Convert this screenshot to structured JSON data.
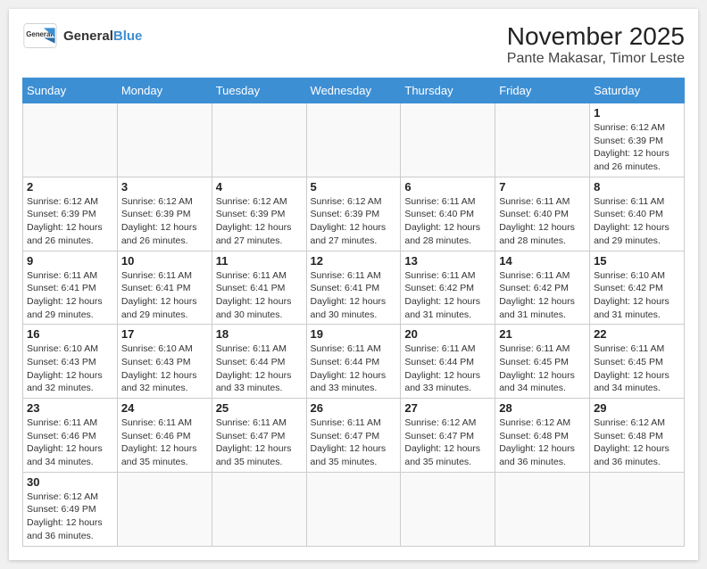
{
  "logo": {
    "text_general": "General",
    "text_blue": "Blue"
  },
  "title": "November 2025",
  "subtitle": "Pante Makasar, Timor Leste",
  "days_of_week": [
    "Sunday",
    "Monday",
    "Tuesday",
    "Wednesday",
    "Thursday",
    "Friday",
    "Saturday"
  ],
  "weeks": [
    [
      {
        "day": "",
        "info": ""
      },
      {
        "day": "",
        "info": ""
      },
      {
        "day": "",
        "info": ""
      },
      {
        "day": "",
        "info": ""
      },
      {
        "day": "",
        "info": ""
      },
      {
        "day": "",
        "info": ""
      },
      {
        "day": "1",
        "info": "Sunrise: 6:12 AM\nSunset: 6:39 PM\nDaylight: 12 hours and 26 minutes."
      }
    ],
    [
      {
        "day": "2",
        "info": "Sunrise: 6:12 AM\nSunset: 6:39 PM\nDaylight: 12 hours and 26 minutes."
      },
      {
        "day": "3",
        "info": "Sunrise: 6:12 AM\nSunset: 6:39 PM\nDaylight: 12 hours and 26 minutes."
      },
      {
        "day": "4",
        "info": "Sunrise: 6:12 AM\nSunset: 6:39 PM\nDaylight: 12 hours and 27 minutes."
      },
      {
        "day": "5",
        "info": "Sunrise: 6:12 AM\nSunset: 6:39 PM\nDaylight: 12 hours and 27 minutes."
      },
      {
        "day": "6",
        "info": "Sunrise: 6:11 AM\nSunset: 6:40 PM\nDaylight: 12 hours and 28 minutes."
      },
      {
        "day": "7",
        "info": "Sunrise: 6:11 AM\nSunset: 6:40 PM\nDaylight: 12 hours and 28 minutes."
      },
      {
        "day": "8",
        "info": "Sunrise: 6:11 AM\nSunset: 6:40 PM\nDaylight: 12 hours and 29 minutes."
      }
    ],
    [
      {
        "day": "9",
        "info": "Sunrise: 6:11 AM\nSunset: 6:41 PM\nDaylight: 12 hours and 29 minutes."
      },
      {
        "day": "10",
        "info": "Sunrise: 6:11 AM\nSunset: 6:41 PM\nDaylight: 12 hours and 29 minutes."
      },
      {
        "day": "11",
        "info": "Sunrise: 6:11 AM\nSunset: 6:41 PM\nDaylight: 12 hours and 30 minutes."
      },
      {
        "day": "12",
        "info": "Sunrise: 6:11 AM\nSunset: 6:41 PM\nDaylight: 12 hours and 30 minutes."
      },
      {
        "day": "13",
        "info": "Sunrise: 6:11 AM\nSunset: 6:42 PM\nDaylight: 12 hours and 31 minutes."
      },
      {
        "day": "14",
        "info": "Sunrise: 6:11 AM\nSunset: 6:42 PM\nDaylight: 12 hours and 31 minutes."
      },
      {
        "day": "15",
        "info": "Sunrise: 6:10 AM\nSunset: 6:42 PM\nDaylight: 12 hours and 31 minutes."
      }
    ],
    [
      {
        "day": "16",
        "info": "Sunrise: 6:10 AM\nSunset: 6:43 PM\nDaylight: 12 hours and 32 minutes."
      },
      {
        "day": "17",
        "info": "Sunrise: 6:10 AM\nSunset: 6:43 PM\nDaylight: 12 hours and 32 minutes."
      },
      {
        "day": "18",
        "info": "Sunrise: 6:11 AM\nSunset: 6:44 PM\nDaylight: 12 hours and 33 minutes."
      },
      {
        "day": "19",
        "info": "Sunrise: 6:11 AM\nSunset: 6:44 PM\nDaylight: 12 hours and 33 minutes."
      },
      {
        "day": "20",
        "info": "Sunrise: 6:11 AM\nSunset: 6:44 PM\nDaylight: 12 hours and 33 minutes."
      },
      {
        "day": "21",
        "info": "Sunrise: 6:11 AM\nSunset: 6:45 PM\nDaylight: 12 hours and 34 minutes."
      },
      {
        "day": "22",
        "info": "Sunrise: 6:11 AM\nSunset: 6:45 PM\nDaylight: 12 hours and 34 minutes."
      }
    ],
    [
      {
        "day": "23",
        "info": "Sunrise: 6:11 AM\nSunset: 6:46 PM\nDaylight: 12 hours and 34 minutes."
      },
      {
        "day": "24",
        "info": "Sunrise: 6:11 AM\nSunset: 6:46 PM\nDaylight: 12 hours and 35 minutes."
      },
      {
        "day": "25",
        "info": "Sunrise: 6:11 AM\nSunset: 6:47 PM\nDaylight: 12 hours and 35 minutes."
      },
      {
        "day": "26",
        "info": "Sunrise: 6:11 AM\nSunset: 6:47 PM\nDaylight: 12 hours and 35 minutes."
      },
      {
        "day": "27",
        "info": "Sunrise: 6:12 AM\nSunset: 6:47 PM\nDaylight: 12 hours and 35 minutes."
      },
      {
        "day": "28",
        "info": "Sunrise: 6:12 AM\nSunset: 6:48 PM\nDaylight: 12 hours and 36 minutes."
      },
      {
        "day": "29",
        "info": "Sunrise: 6:12 AM\nSunset: 6:48 PM\nDaylight: 12 hours and 36 minutes."
      }
    ],
    [
      {
        "day": "30",
        "info": "Sunrise: 6:12 AM\nSunset: 6:49 PM\nDaylight: 12 hours and 36 minutes."
      },
      {
        "day": "",
        "info": ""
      },
      {
        "day": "",
        "info": ""
      },
      {
        "day": "",
        "info": ""
      },
      {
        "day": "",
        "info": ""
      },
      {
        "day": "",
        "info": ""
      },
      {
        "day": "",
        "info": ""
      }
    ]
  ]
}
